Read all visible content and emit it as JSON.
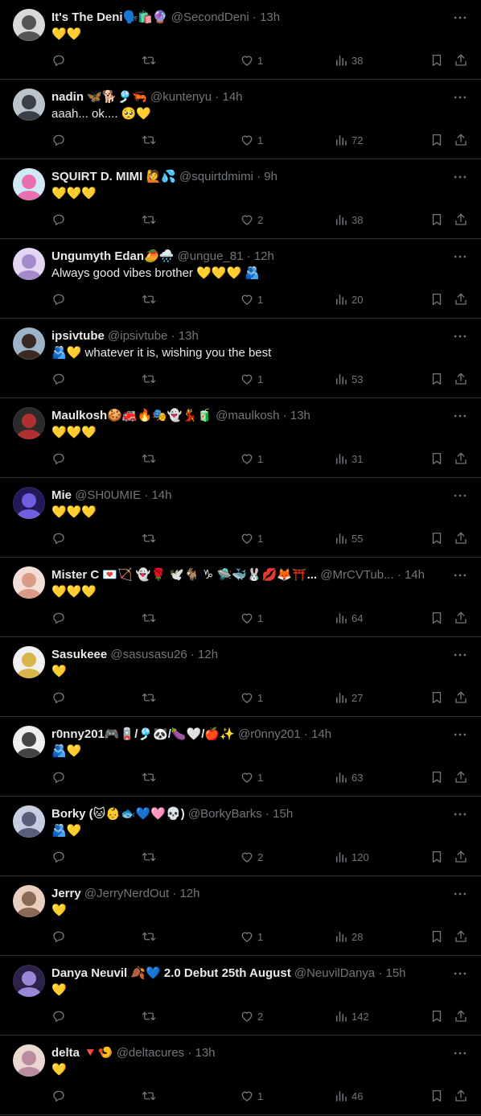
{
  "tweets": [
    {
      "name": "It's The Deni🗣️🛍️🔮",
      "handle": "@SecondDeni",
      "time": "13h",
      "text": "💛💛",
      "replies": "",
      "likes": "1",
      "views": "38",
      "avatar_bg": "#d9d9d9",
      "avatar_fg": "#555555"
    },
    {
      "name": "nadin 🦋🐕🎐🦐",
      "handle": "@kuntenyu",
      "time": "14h",
      "text": "aaah... ok.... 🥺💛",
      "replies": "",
      "likes": "1",
      "views": "72",
      "avatar_bg": "#b9c4cc",
      "avatar_fg": "#3a3f48"
    },
    {
      "name": "SQUIRT D. MIMI 🙋💦",
      "handle": "@squirtdmimi",
      "time": "9h",
      "text": "💛💛💛",
      "replies": "",
      "likes": "2",
      "views": "38",
      "avatar_bg": "#cfe9f5",
      "avatar_fg": "#e86fb0"
    },
    {
      "name": "Ungumyth Edan🥭🌧️",
      "handle": "@ungue_81",
      "time": "12h",
      "text": "Always good vibes brother 💛💛💛 🫂",
      "replies": "",
      "likes": "1",
      "views": "20",
      "avatar_bg": "#e3d6f2",
      "avatar_fg": "#a38ac9"
    },
    {
      "name": "ipsivtube",
      "handle": "@ipsivtube",
      "time": "13h",
      "text": "🫂💛 whatever it is, wishing you the best",
      "replies": "",
      "likes": "1",
      "views": "53",
      "avatar_bg": "#9db3c7",
      "avatar_fg": "#3b2a24"
    },
    {
      "name": "Maulkosh🍪🚒🔥🎭👻💃🧃",
      "handle": "@maulkosh",
      "time": "13h",
      "text": "💛💛💛",
      "replies": "",
      "likes": "1",
      "views": "31",
      "avatar_bg": "#2b2b2b",
      "avatar_fg": "#b03030"
    },
    {
      "name": "Mie",
      "handle": "@SH0UMIE",
      "time": "14h",
      "text": "💛💛💛",
      "replies": "",
      "likes": "1",
      "views": "55",
      "avatar_bg": "#241a5a",
      "avatar_fg": "#6f5fe0"
    },
    {
      "name": "Mister C 💌🏹 👻🌹 🕊️🐐 ♑ 🛸🐳🐰💋🦊⛩️...",
      "handle": "@MrCVTub...",
      "time": "14h",
      "text": "💛💛💛",
      "replies": "",
      "likes": "1",
      "views": "64",
      "avatar_bg": "#f3ddd5",
      "avatar_fg": "#d99a86"
    },
    {
      "name": "Sasukeee",
      "handle": "@sasusasu26",
      "time": "12h",
      "text": "💛",
      "replies": "",
      "likes": "1",
      "views": "27",
      "avatar_bg": "#f1f1f1",
      "avatar_fg": "#d9b44a"
    },
    {
      "name": "r0nny201🎮🪫/🎐🐼/🍆🤍/🍎✨",
      "handle": "@r0nny201",
      "time": "14h",
      "text": "🫂💛",
      "replies": "",
      "likes": "1",
      "views": "63",
      "avatar_bg": "#eeeeee",
      "avatar_fg": "#444444"
    },
    {
      "name": "Borky (🐱👶🐟💙🩷💀)",
      "handle": "@BorkyBarks",
      "time": "15h",
      "text": "🫂💛",
      "replies": "",
      "likes": "2",
      "views": "120",
      "avatar_bg": "#c7cde0",
      "avatar_fg": "#5b5e7a"
    },
    {
      "name": "Jerry",
      "handle": "@JerryNerdOut",
      "time": "12h",
      "text": "💛",
      "replies": "",
      "likes": "1",
      "views": "28",
      "avatar_bg": "#e8cfc0",
      "avatar_fg": "#8b6a55"
    },
    {
      "name": "Danya Neuvil 🍂💙 2.0 Debut 25th August",
      "handle": "@NeuvilDanya",
      "time": "15h",
      "text": "💛",
      "replies": "",
      "likes": "2",
      "views": "142",
      "avatar_bg": "#2c2148",
      "avatar_fg": "#9a86d6"
    },
    {
      "name": "delta 🔻🍤",
      "handle": "@deltacures",
      "time": "13h",
      "text": "💛",
      "replies": "",
      "likes": "1",
      "views": "46",
      "avatar_bg": "#e9d8d0",
      "avatar_fg": "#b98ca0"
    }
  ],
  "icons": {
    "more": "more-icon",
    "reply": "reply-icon",
    "retweet": "retweet-icon",
    "like": "heart-icon",
    "views": "views-icon",
    "bookmark": "bookmark-icon",
    "share": "share-icon"
  },
  "colors": {
    "background": "#000000",
    "text": "#e7e9ea",
    "muted": "#71767b",
    "divider": "#2f3336"
  }
}
